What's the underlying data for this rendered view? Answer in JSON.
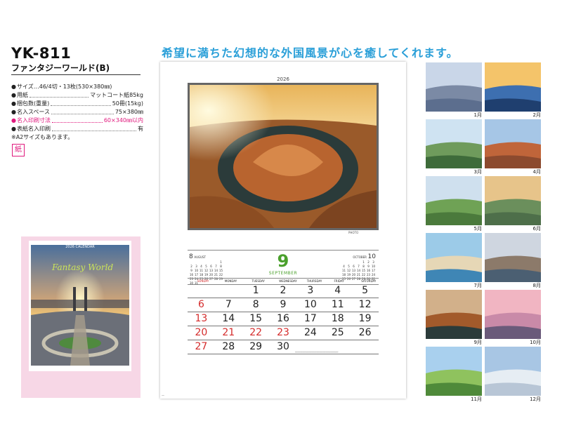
{
  "product": {
    "code": "YK-811",
    "name": "ファンタジーワールド(B)"
  },
  "specs": [
    {
      "label": "サイズ…46/4切・13枚(530×380㎜)",
      "value": "",
      "pink": false,
      "lead": false
    },
    {
      "label": "用紙",
      "value": "マットコート紙85kg",
      "pink": false,
      "lead": true
    },
    {
      "label": "梱包数(重量)",
      "value": "50冊(15kg)",
      "pink": false,
      "lead": true
    },
    {
      "label": "名入スペース",
      "value": "75×380㎜",
      "pink": false,
      "lead": true
    },
    {
      "label": "名入印刷寸法",
      "value": "60×340㎜以内",
      "pink": true,
      "lead": true
    },
    {
      "label": "表紙名入印刷",
      "value": "有",
      "pink": false,
      "lead": true
    }
  ],
  "note": "※A2サイズもあります。",
  "paper_badge": "紙",
  "headline": "希望に満ちた幻想的な外国風景が心を癒してくれます。",
  "cover_thumb": {
    "caption": "2026 CALENDAR",
    "logo": "Fantasy World"
  },
  "calendar": {
    "year": "2026",
    "month_number": "9",
    "month_name": "SEPTEMBER",
    "prev_month": {
      "num": "8",
      "name": "AUGUST",
      "days": [
        "",
        "",
        "",
        "",
        "",
        "",
        "1",
        "2",
        "3",
        "4",
        "5",
        "6",
        "7",
        "8",
        "9",
        "10",
        "11",
        "12",
        "13",
        "14",
        "15",
        "16",
        "17",
        "18",
        "19",
        "20",
        "21",
        "22",
        "23",
        "24",
        "25",
        "26",
        "27",
        "28",
        "29",
        "30",
        "31"
      ]
    },
    "next_month": {
      "num": "10",
      "name": "OCTOBER",
      "days": [
        "",
        "",
        "",
        "",
        "1",
        "2",
        "3",
        "4",
        "5",
        "6",
        "7",
        "8",
        "9",
        "10",
        "11",
        "12",
        "13",
        "14",
        "15",
        "16",
        "17",
        "18",
        "19",
        "20",
        "21",
        "22",
        "23",
        "24",
        "25",
        "26",
        "27",
        "28",
        "29",
        "30",
        "31"
      ]
    },
    "weekdays": [
      "SUNDAY",
      "MONDAY",
      "TUESDAY",
      "WEDNESDAY",
      "THURSDAY",
      "FRIDAY",
      "SATURDAY"
    ],
    "weeks": [
      [
        "",
        "",
        "1",
        "2",
        "3",
        "4",
        "5"
      ],
      [
        "6",
        "7",
        "8",
        "9",
        "10",
        "11",
        "12"
      ],
      [
        "13",
        "14",
        "15",
        "16",
        "17",
        "18",
        "19"
      ],
      [
        "20",
        "21",
        "22",
        "23",
        "24",
        "25",
        "26"
      ],
      [
        "27",
        "28",
        "29",
        "30",
        "",
        "",
        ""
      ]
    ],
    "red_days": [
      "6",
      "13",
      "20",
      "21",
      "22",
      "23",
      "27"
    ]
  },
  "months": [
    "1月",
    "2月",
    "3月",
    "4月",
    "5月",
    "6月",
    "7月",
    "8月",
    "9月",
    "10月",
    "11月",
    "12月"
  ]
}
